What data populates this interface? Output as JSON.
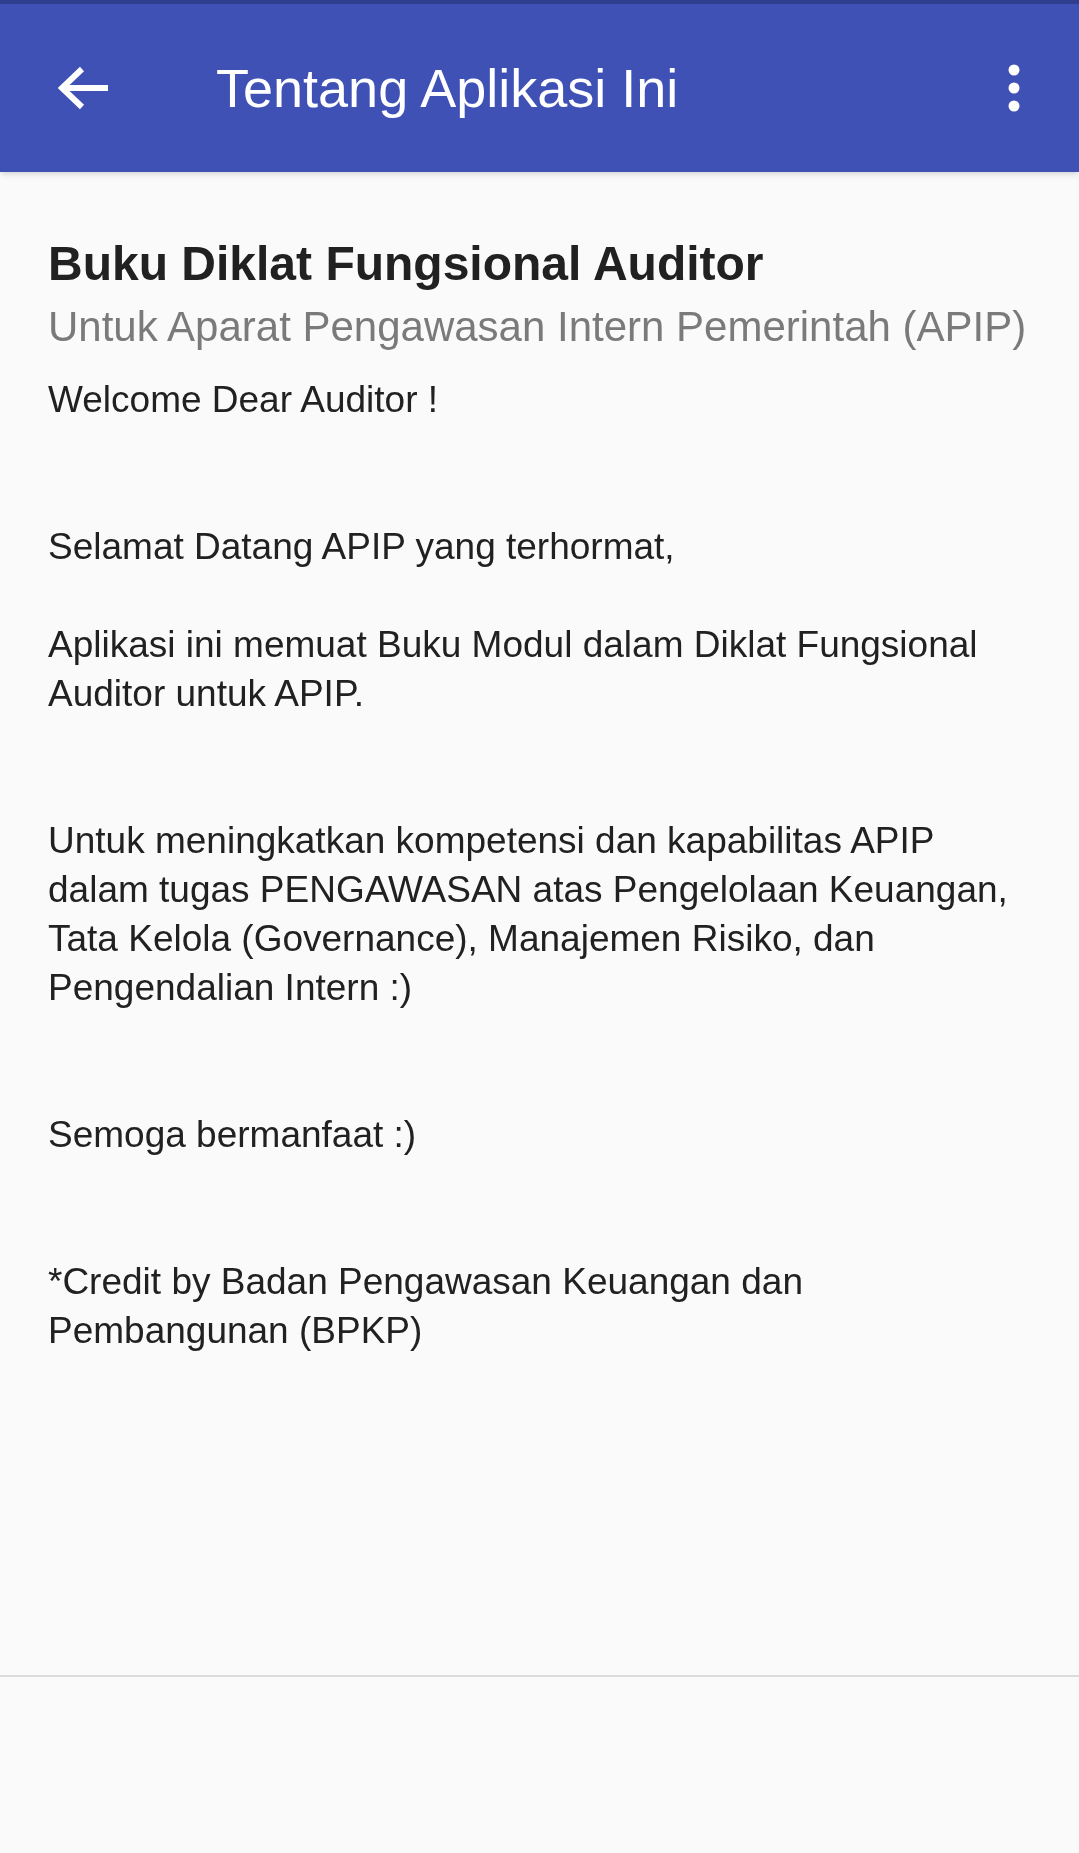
{
  "app_bar": {
    "title": "Tentang Aplikasi Ini"
  },
  "content": {
    "heading": "Buku Diklat Fungsional Auditor",
    "subtitle": "Untuk Aparat Pengawasan Intern Pemerintah (APIP)",
    "sections": [
      {
        "paragraphs": [
          "Welcome Dear Auditor !"
        ]
      },
      {
        "paragraphs": [
          "Selamat Datang APIP yang terhormat,",
          "Aplikasi ini memuat Buku Modul dalam Diklat Fungsional Auditor untuk APIP."
        ]
      },
      {
        "paragraphs": [
          "Untuk meningkatkan kompetensi dan kapabilitas APIP dalam tugas PENGAWASAN atas Pengelolaan Keuangan, Tata Kelola (Governance), Manajemen Risiko, dan Pengendalian Intern :)"
        ]
      },
      {
        "paragraphs": [
          "Semoga bermanfaat :)"
        ]
      },
      {
        "paragraphs": [
          "*Credit by Badan Pengawasan Keuangan dan Pembangunan (BPKP)"
        ]
      }
    ]
  }
}
